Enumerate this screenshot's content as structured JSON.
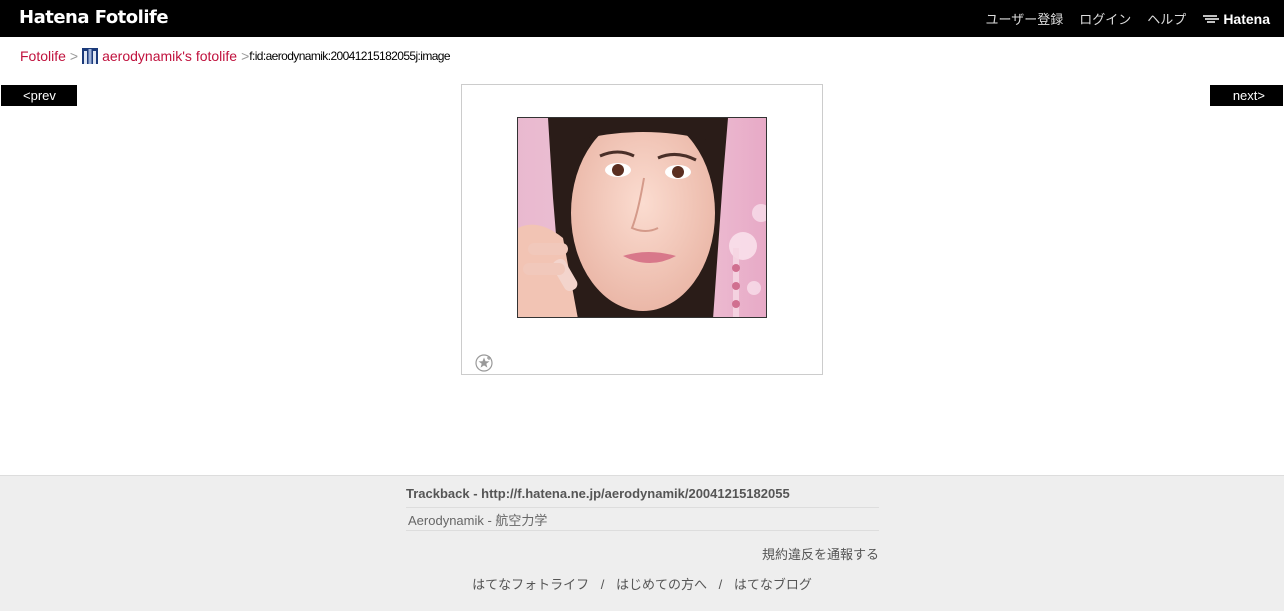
{
  "header": {
    "logo": "Hatena Fotolife",
    "nav": [
      "ユーザー登録",
      "ログイン",
      "ヘルプ"
    ],
    "brand": "Hatena"
  },
  "breadcrumb": {
    "root": "Fotolife",
    "sep": ">",
    "user": "aerodynamik's fotolife",
    "current": "f:id:aerodynamik:20041215182055j:image"
  },
  "pager": {
    "prev": "<prev",
    "next": "next>"
  },
  "photo": {
    "icons": [
      "add-star-icon"
    ]
  },
  "footer": {
    "trackback": "Trackback - http://f.hatena.ne.jp/aerodynamik/20041215182055",
    "trackback_item": "Aerodynamik - 航空力学",
    "report": "規約違反を通報する",
    "links": [
      "はてなフォトライフ",
      "はじめての方へ",
      "はてなブログ"
    ],
    "link_sep": "/"
  },
  "colors": {
    "link": "#c0113d",
    "header_bg": "#000000",
    "footer_bg": "#eeeeee"
  }
}
